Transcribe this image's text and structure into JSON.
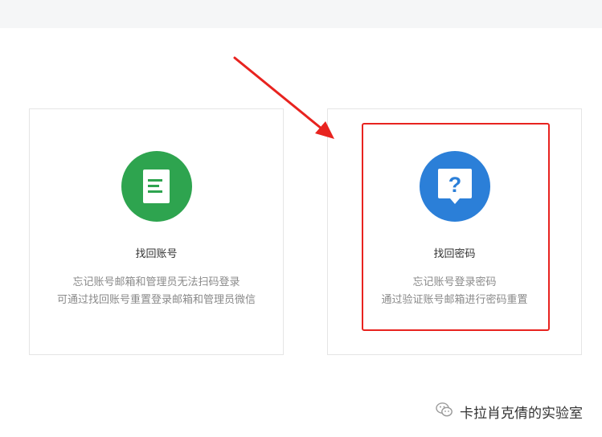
{
  "theme": {
    "account_color": "#2ea44f",
    "password_color": "#2b7fd8",
    "annotation_color": "#e8231f"
  },
  "cards": {
    "account": {
      "icon": "document-icon",
      "title": "找回账号",
      "desc_line1": "忘记账号邮箱和管理员无法扫码登录",
      "desc_line2": "可通过找回账号重置登录邮箱和管理员微信"
    },
    "password": {
      "icon": "question-bubble-icon",
      "title": "找回密码",
      "desc_line1": "忘记账号登录密码",
      "desc_line2": "通过验证账号邮箱进行密码重置"
    }
  },
  "watermark": {
    "icon": "wechat-icon",
    "text": "卡拉肖克倩的实验室"
  }
}
